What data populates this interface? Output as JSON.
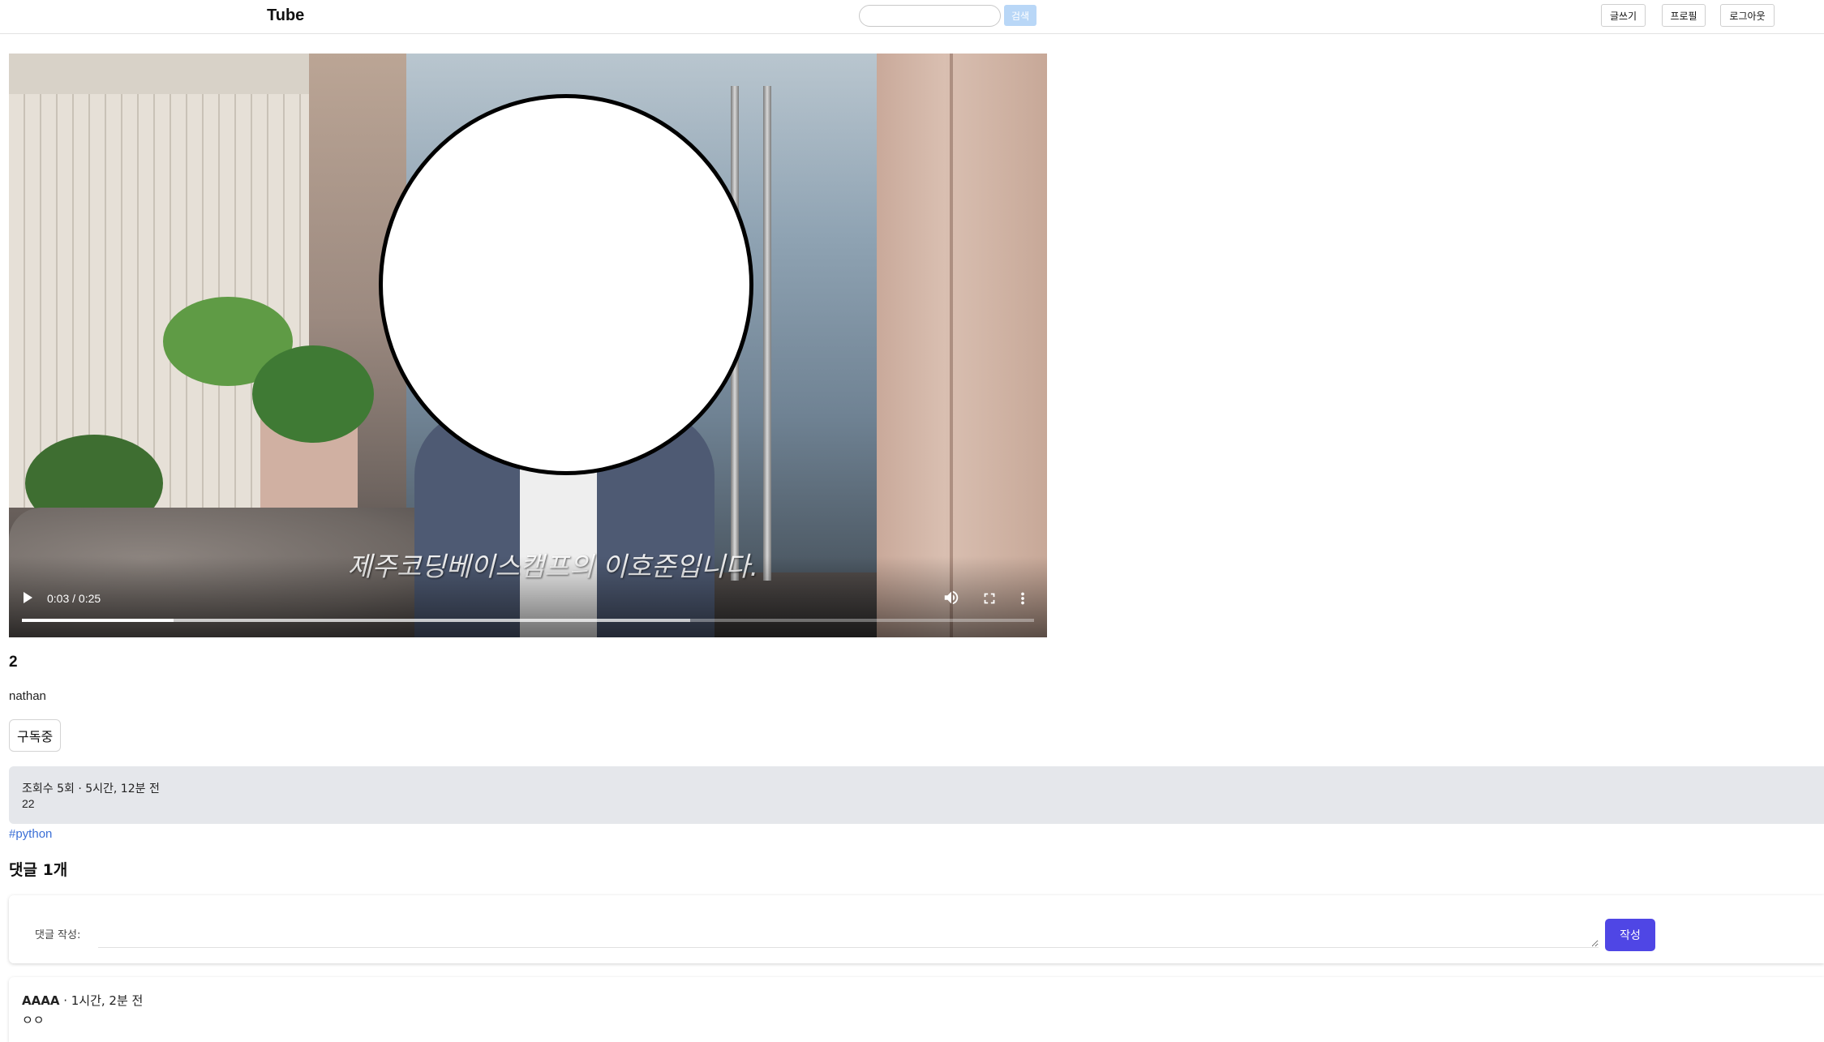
{
  "header": {
    "logo": "Tube",
    "search": {
      "placeholder": "",
      "value": "",
      "button_label": "검색"
    },
    "nav": {
      "write_label": "글쓰기",
      "profile_label": "프로필",
      "logout_label": "로그아웃"
    }
  },
  "video": {
    "subtitle": "제주코딩베이스캠프의 이호준입니다.",
    "time": "0:03 / 0:25",
    "progress": 0.15,
    "buffered": 0.66,
    "icons": {
      "play": "play-icon",
      "volume": "volume-icon",
      "fullscreen": "fullscreen-icon",
      "more": "more-vertical-icon"
    }
  },
  "meta": {
    "title": "2",
    "channel": "nathan",
    "subscribe_label": "구독중",
    "stats": "조회수 5회 · 5시간, 12분 전",
    "description": "22",
    "hashtag": "#python"
  },
  "comments": {
    "heading": "댓글 1개",
    "form": {
      "label": "댓글 작성:",
      "placeholder": "",
      "submit_label": "작성"
    },
    "items": [
      {
        "author": "AAAA",
        "time": " · 1시간, 2분 전",
        "body": "ㅇㅇ"
      }
    ]
  },
  "colors": {
    "accent": "#4f46e5",
    "search_button": "#b9d7f7",
    "hashtag": "#3b6fd6",
    "desc_bg": "#e5e7eb"
  }
}
